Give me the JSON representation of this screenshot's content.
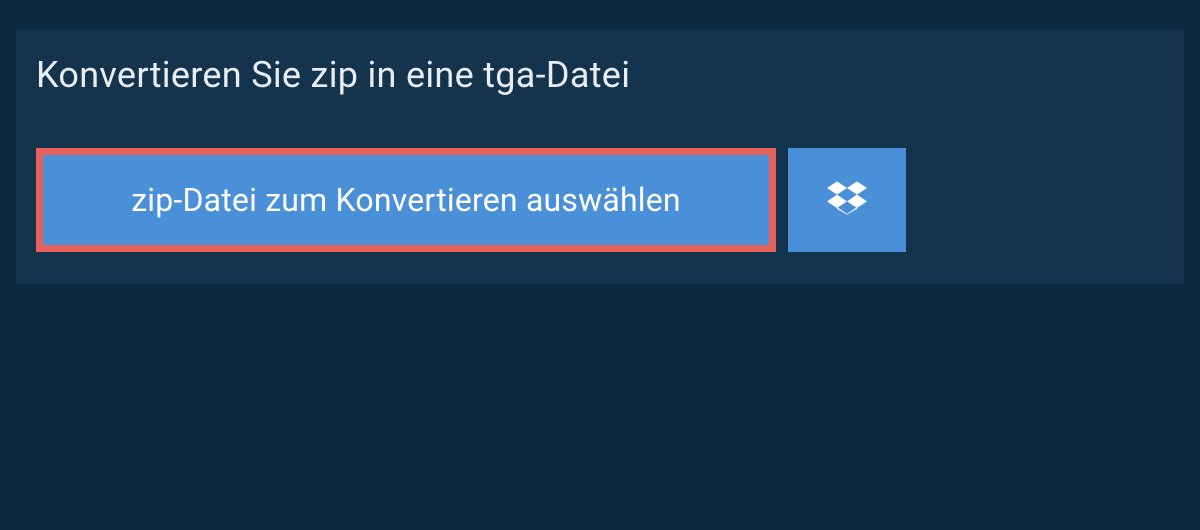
{
  "heading": "Konvertieren Sie zip in eine tga-Datei",
  "select_file_label": "zip-Datei zum Konvertieren auswählen",
  "colors": {
    "background": "#0f2a3f",
    "panel": "#14334d",
    "button": "#4a90d9",
    "highlight_border": "#e5615a",
    "text_light": "#e8edf2",
    "text_white": "#ffffff"
  }
}
